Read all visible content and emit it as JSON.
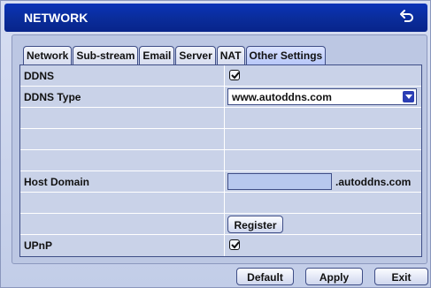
{
  "window": {
    "title": "NETWORK",
    "back_icon": "back-arrow-icon"
  },
  "tabs": [
    {
      "label": "Network"
    },
    {
      "label": "Sub-stream"
    },
    {
      "label": "Email"
    },
    {
      "label": "Server"
    },
    {
      "label": "NAT"
    },
    {
      "label": "Other Settings",
      "active": true
    }
  ],
  "settings": {
    "ddns_label": "DDNS",
    "ddns_checked": true,
    "ddns_type_label": "DDNS Type",
    "ddns_type_value": "www.autoddns.com",
    "host_domain_label": "Host Domain",
    "host_domain_value": "",
    "host_domain_suffix": ".autoddns.com",
    "register_label": "Register",
    "upnp_label": "UPnP",
    "upnp_checked": true
  },
  "footer": {
    "default_label": "Default",
    "apply_label": "Apply",
    "exit_label": "Exit"
  },
  "colors": {
    "title_bar": "#0a33b8",
    "panel_bg": "#c9d2e8",
    "accent": "#2b3eb4"
  }
}
